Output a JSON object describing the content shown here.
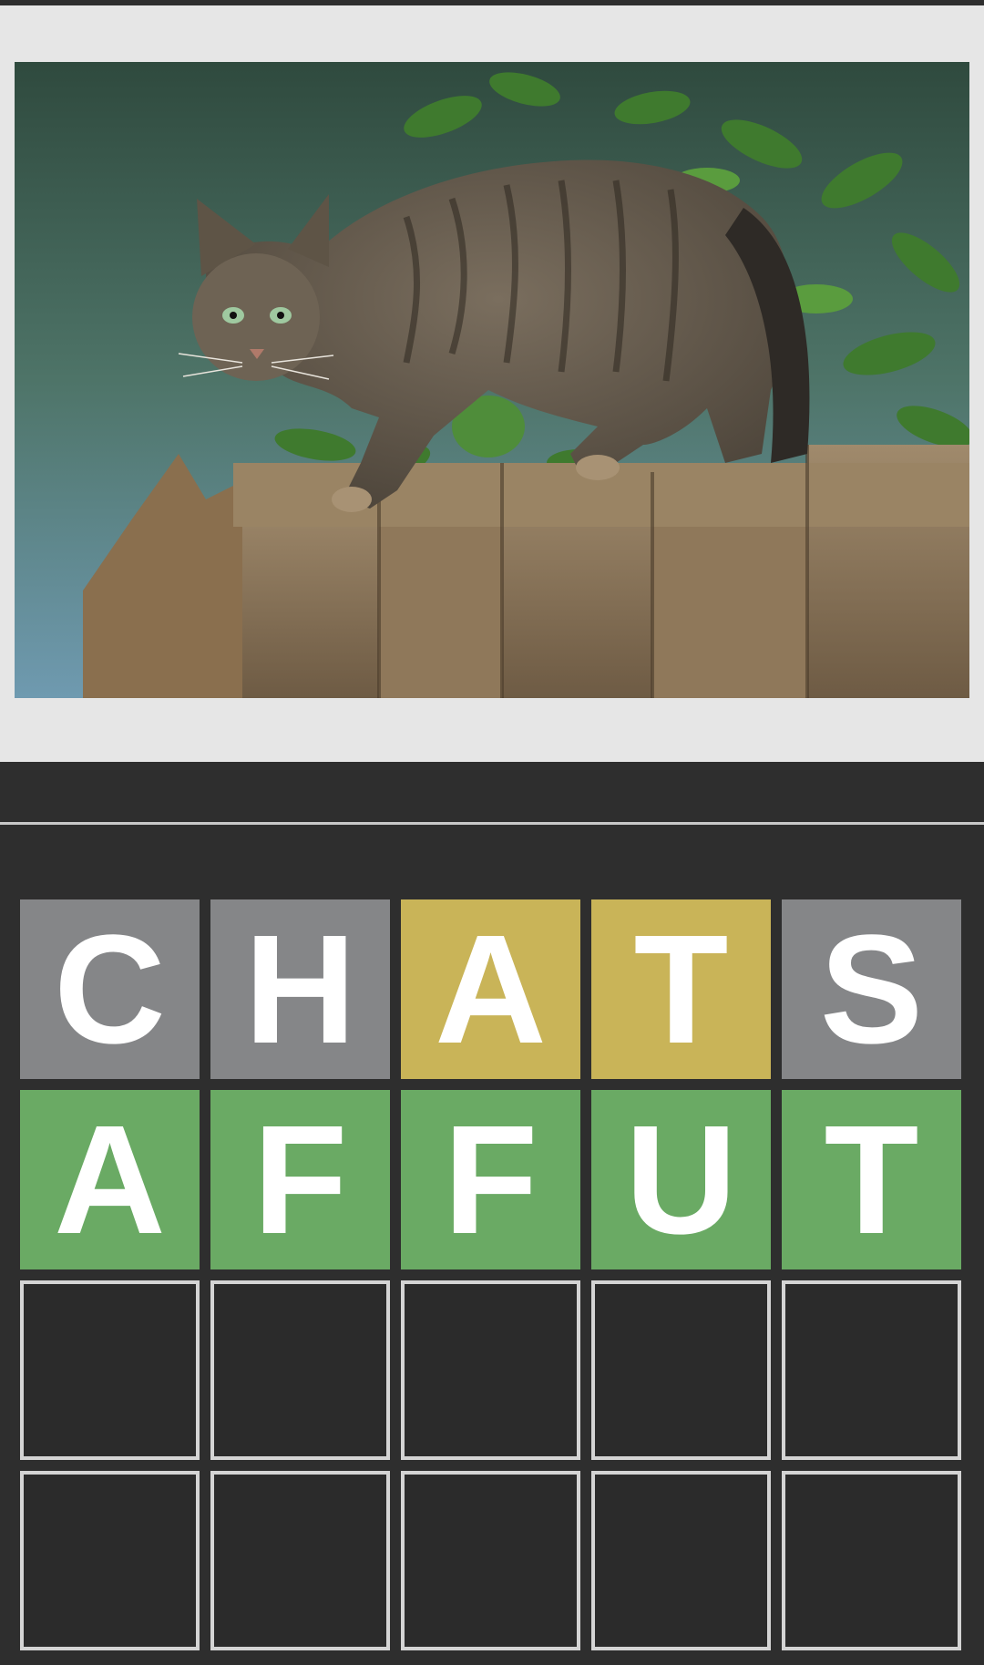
{
  "photo": {
    "subject": "tabby cat standing on a wooden fence with green leaves"
  },
  "board": {
    "rows": [
      {
        "tiles": [
          {
            "letter": "C",
            "state": "absent"
          },
          {
            "letter": "H",
            "state": "absent"
          },
          {
            "letter": "A",
            "state": "present"
          },
          {
            "letter": "T",
            "state": "present"
          },
          {
            "letter": "S",
            "state": "absent"
          }
        ]
      },
      {
        "tiles": [
          {
            "letter": "A",
            "state": "correct"
          },
          {
            "letter": "F",
            "state": "correct"
          },
          {
            "letter": "F",
            "state": "correct"
          },
          {
            "letter": "U",
            "state": "correct"
          },
          {
            "letter": "T",
            "state": "correct"
          }
        ]
      },
      {
        "tiles": [
          {
            "letter": "",
            "state": "empty"
          },
          {
            "letter": "",
            "state": "empty"
          },
          {
            "letter": "",
            "state": "empty"
          },
          {
            "letter": "",
            "state": "empty"
          },
          {
            "letter": "",
            "state": "empty"
          }
        ]
      },
      {
        "tiles": [
          {
            "letter": "",
            "state": "empty"
          },
          {
            "letter": "",
            "state": "empty"
          },
          {
            "letter": "",
            "state": "empty"
          },
          {
            "letter": "",
            "state": "empty"
          },
          {
            "letter": "",
            "state": "empty"
          }
        ]
      }
    ]
  },
  "colors": {
    "absent": "#858688",
    "present": "#c9b458",
    "correct": "#6aaa64",
    "background": "#2e2e2e"
  }
}
